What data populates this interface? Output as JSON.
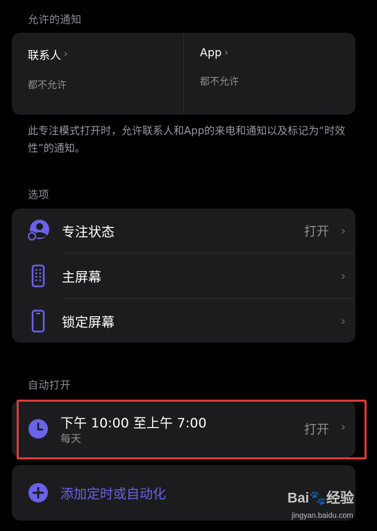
{
  "allowed": {
    "header": "允许的通知",
    "people": {
      "title": "联系人",
      "subtitle": "都不允许"
    },
    "apps": {
      "title": "App",
      "subtitle": "都不允许"
    },
    "footer": "此专注模式打开时，允许联系人和App的来电和通知以及标记为“时效性”的通知。"
  },
  "options": {
    "header": "选项",
    "items": [
      {
        "label": "专注状态",
        "value": "打开",
        "icon": "focus-status-icon"
      },
      {
        "label": "主屏幕",
        "value": "",
        "icon": "home-screen-icon"
      },
      {
        "label": "锁定屏幕",
        "value": "",
        "icon": "lock-screen-icon"
      }
    ]
  },
  "auto": {
    "header": "自动打开",
    "schedule": {
      "title": "下午 10:00 至上午 7:00",
      "subtitle": "每天",
      "value": "打开",
      "icon": "clock-icon"
    },
    "add_label": "添加定时或自动化",
    "add_icon": "plus-circle-icon"
  },
  "watermark": {
    "logo": "Bai🐾经验",
    "url": "jingyan.baidu.com"
  },
  "colors": {
    "accent": "#6a62e8",
    "background": "#000000",
    "card": "#1c1c1e",
    "highlight": "#e03a3a"
  }
}
